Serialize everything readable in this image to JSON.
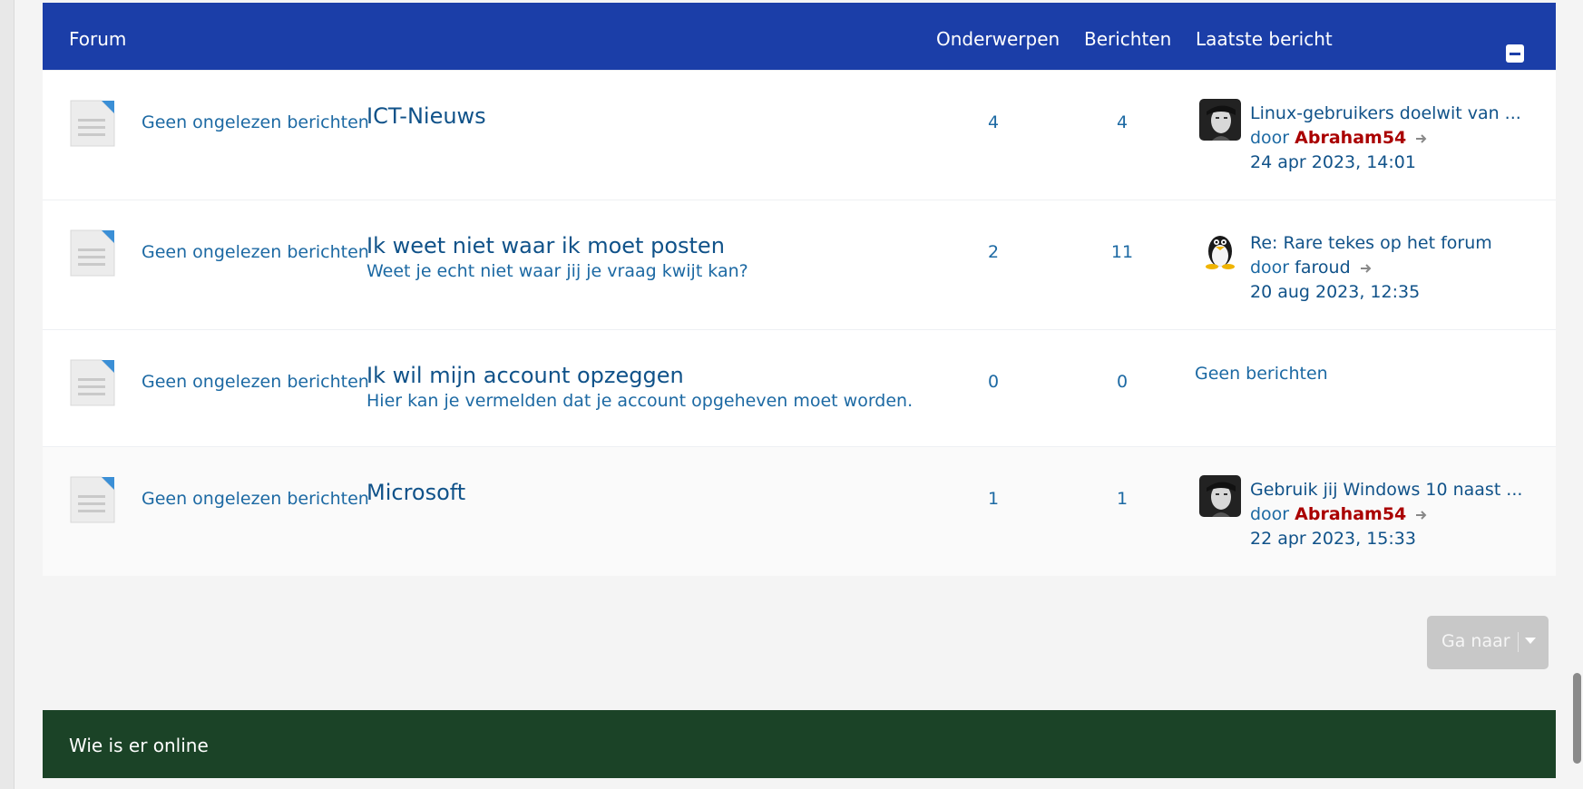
{
  "header": {
    "forum": "Forum",
    "topics": "Onderwerpen",
    "posts": "Berichten",
    "last_post": "Laatste bericht"
  },
  "rows": [
    {
      "unread": "Geen ongelezen berichten",
      "title": "ICT-Nieuws",
      "description": "",
      "topics": "4",
      "posts": "4",
      "last_title": "Linux-gebruikers doelwit van ...",
      "by_prefix": "door",
      "author": "Abraham54",
      "date": "24 apr 2023, 14:01"
    },
    {
      "unread": "Geen ongelezen berichten",
      "title": "Ik weet niet waar ik moet posten",
      "description": "Weet je echt niet waar jij je vraag kwijt kan?",
      "topics": "2",
      "posts": "11",
      "last_title": "Re: Rare tekes op het forum",
      "by_prefix": "door",
      "author": "faroud",
      "date": "20 aug 2023, 12:35"
    },
    {
      "unread": "Geen ongelezen berichten",
      "title": "Ik wil mijn account opzeggen",
      "description": "Hier kan je vermelden dat je account opgeheven moet worden.",
      "topics": "0",
      "posts": "0",
      "no_posts": "Geen berichten"
    },
    {
      "unread": "Geen ongelezen berichten",
      "title": "Microsoft",
      "description": "",
      "topics": "1",
      "posts": "1",
      "last_title": "Gebruik jij Windows 10 naast ...",
      "by_prefix": "door",
      "author": "Abraham54",
      "date": "22 apr 2023, 15:33"
    }
  ],
  "jumpbox": {
    "label": "Ga naar"
  },
  "online": {
    "title": "Wie is er online"
  },
  "colors": {
    "forum_header": "#1b3ea8",
    "online_header": "#1b4327",
    "author_red": "#aa0000",
    "link_blue": "#105289"
  },
  "icons": {
    "forum_status": "forum-read-icon",
    "goto": "arrow-right-icon",
    "collapse": "minus-icon",
    "jump_caret": "caret-down-icon"
  }
}
